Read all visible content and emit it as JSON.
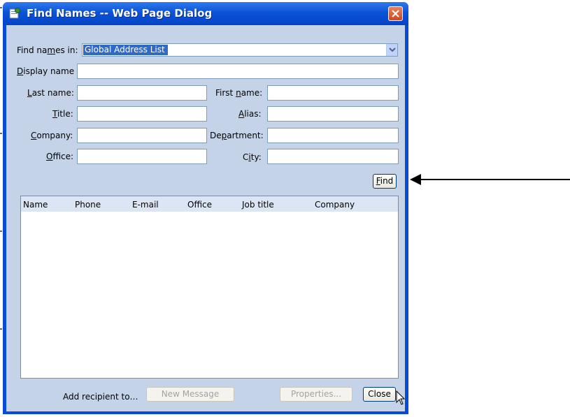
{
  "window": {
    "title": "Find Names -- Web Page Dialog"
  },
  "form": {
    "find_in_label_pre": "Find na",
    "find_in_label_key": "m",
    "find_in_label_post": "es in:",
    "find_in_value": "Global Address List",
    "display_name_key": "D",
    "display_name_rest": "isplay name",
    "last_name_key": "L",
    "last_name_rest": "ast name:",
    "first_name_pre": "First ",
    "first_name_key": "n",
    "first_name_post": "ame:",
    "title_key": "T",
    "title_rest": "itle:",
    "alias_key": "A",
    "alias_rest": "lias:",
    "company_key": "C",
    "company_rest": "ompany:",
    "department_pre": "De",
    "department_key": "p",
    "department_post": "artment:",
    "office_key": "O",
    "office_rest": "ffice:",
    "city_pre": "C",
    "city_key": "i",
    "city_post": "ty:",
    "display_name_value": "",
    "last_name_value": "",
    "first_name_value": "",
    "title_value": "",
    "alias_value": "",
    "company_value": "",
    "department_value": "",
    "office_value": "",
    "city_value": ""
  },
  "find_button": {
    "key": "F",
    "rest": "ind"
  },
  "results": {
    "columns": [
      "Name",
      "Phone",
      "E-mail",
      "Office",
      "Job title",
      "Company"
    ]
  },
  "footer": {
    "add_recipient_label": "Add recipient to…",
    "new_message_label": "New Message",
    "properties_label": "Properties...",
    "close_label": "Close"
  },
  "colors": {
    "titlebar": "#0b53d6",
    "client": "#c4d3e8",
    "selection": "#316ac5",
    "close_button": "#c94821"
  }
}
